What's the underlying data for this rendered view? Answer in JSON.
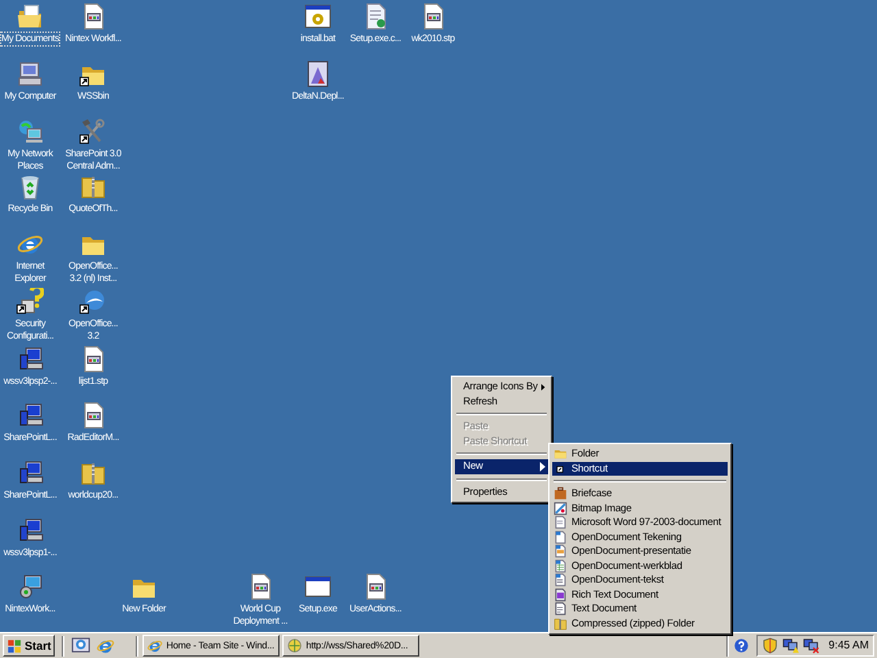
{
  "desktop": {
    "icons": [
      {
        "label": "My Documents",
        "kind": "folder-docs",
        "shortcut": false,
        "focused": true
      },
      {
        "label": "Nintex Workfl...",
        "kind": "document",
        "shortcut": false,
        "focused": false
      },
      {
        "label": "My Computer",
        "kind": "computer",
        "shortcut": false,
        "focused": false
      },
      {
        "label": "WSSbin",
        "kind": "folder",
        "shortcut": true,
        "focused": false
      },
      {
        "label": "My Network Places",
        "kind": "network",
        "shortcut": false,
        "focused": false
      },
      {
        "label": "SharePoint 3.0 Central Adm...",
        "kind": "tools",
        "shortcut": true,
        "focused": false
      },
      {
        "label": "Recycle Bin",
        "kind": "recycle",
        "shortcut": false,
        "focused": false
      },
      {
        "label": "QuoteOfTh...",
        "kind": "zip",
        "shortcut": false,
        "focused": false
      },
      {
        "label": "Internet Explorer",
        "kind": "browser",
        "shortcut": false,
        "focused": false
      },
      {
        "label": "OpenOffice... 3.2 (nl) Inst...",
        "kind": "folder",
        "shortcut": false,
        "focused": false
      },
      {
        "label": "Security Configurati...",
        "kind": "security",
        "shortcut": true,
        "focused": false
      },
      {
        "label": "OpenOffice... 3.2",
        "kind": "office",
        "shortcut": true,
        "focused": false
      },
      {
        "label": "wssv3lpsp2-...",
        "kind": "installer",
        "shortcut": false,
        "focused": false
      },
      {
        "label": "lijst1.stp",
        "kind": "document",
        "shortcut": false,
        "focused": false
      },
      {
        "label": "SharePointL...",
        "kind": "installer",
        "shortcut": false,
        "focused": false
      },
      {
        "label": "RadEditorM...",
        "kind": "document",
        "shortcut": false,
        "focused": false
      },
      {
        "label": "SharePointL...",
        "kind": "installer",
        "shortcut": false,
        "focused": false
      },
      {
        "label": "worldcup20...",
        "kind": "zip",
        "shortcut": false,
        "focused": false
      },
      {
        "label": "wssv3lpsp1-...",
        "kind": "installer",
        "shortcut": false,
        "focused": false
      },
      {
        "label": "NintexWork...",
        "kind": "setup",
        "shortcut": false,
        "focused": false
      },
      {
        "label": "New Folder",
        "kind": "folder",
        "shortcut": false,
        "focused": false
      },
      {
        "label": "World Cup Deployment ...",
        "kind": "document",
        "shortcut": false,
        "focused": false
      },
      {
        "label": "Setup.exe",
        "kind": "window",
        "shortcut": false,
        "focused": false
      },
      {
        "label": "UserActions...",
        "kind": "document",
        "shortcut": false,
        "focused": false
      },
      {
        "label": "install.bat",
        "kind": "gear-window",
        "shortcut": false,
        "focused": false
      },
      {
        "label": "Setup.exe.c...",
        "kind": "config",
        "shortcut": false,
        "focused": false
      },
      {
        "label": "wk2010.stp",
        "kind": "document",
        "shortcut": false,
        "focused": false
      },
      {
        "label": "DeltaN.Depl...",
        "kind": "drawing",
        "shortcut": false,
        "focused": false
      }
    ]
  },
  "context_menu": {
    "items": [
      {
        "kind": "item",
        "label": "Arrange Icons By",
        "submenu": true,
        "disabled": false,
        "selected": false
      },
      {
        "kind": "item",
        "label": "Refresh",
        "submenu": false,
        "disabled": false,
        "selected": false
      },
      {
        "kind": "separator"
      },
      {
        "kind": "item",
        "label": "Paste",
        "submenu": false,
        "disabled": true,
        "selected": false
      },
      {
        "kind": "item",
        "label": "Paste Shortcut",
        "submenu": false,
        "disabled": true,
        "selected": false
      },
      {
        "kind": "separator"
      },
      {
        "kind": "item",
        "label": "New",
        "submenu": true,
        "disabled": false,
        "selected": true
      },
      {
        "kind": "separator"
      },
      {
        "kind": "item",
        "label": "Properties",
        "submenu": false,
        "disabled": false,
        "selected": false
      }
    ]
  },
  "new_submenu": {
    "items": [
      {
        "kind": "folder",
        "label": "Folder",
        "selected": false
      },
      {
        "kind": "shortcut",
        "label": "Shortcut",
        "selected": true
      },
      {
        "kind": "separator"
      },
      {
        "kind": "briefcase",
        "label": "Briefcase",
        "selected": false
      },
      {
        "kind": "bitmap",
        "label": "Bitmap Image",
        "selected": false
      },
      {
        "kind": "document",
        "label": "Microsoft Word 97-2003-document",
        "selected": false
      },
      {
        "kind": "drawing",
        "label": "OpenDocument Tekening",
        "selected": false
      },
      {
        "kind": "presentation",
        "label": "OpenDocument-presentatie",
        "selected": false
      },
      {
        "kind": "spreadsheet",
        "label": "OpenDocument-werkblad",
        "selected": false
      },
      {
        "kind": "text",
        "label": "OpenDocument-tekst",
        "selected": false
      },
      {
        "kind": "rich-text",
        "label": "Rich Text Document",
        "selected": false
      },
      {
        "kind": "plain-text",
        "label": "Text Document",
        "selected": false
      },
      {
        "kind": "zip",
        "label": "Compressed (zipped) Folder",
        "selected": false
      }
    ]
  },
  "taskbar": {
    "start": "Start",
    "quick_launch": [
      {
        "kind": "desktop"
      },
      {
        "kind": "browser"
      }
    ],
    "tasks": [
      {
        "kind": "browser",
        "label": "Home - Team Site - Wind...",
        "selected": false
      },
      {
        "kind": "web",
        "label": "http://wss/Shared%20D...",
        "selected": false
      }
    ],
    "tray": [
      {
        "kind": "help"
      },
      {
        "kind": "shield"
      },
      {
        "kind": "network"
      },
      {
        "kind": "network-off"
      }
    ],
    "clock": "9:45 AM"
  }
}
